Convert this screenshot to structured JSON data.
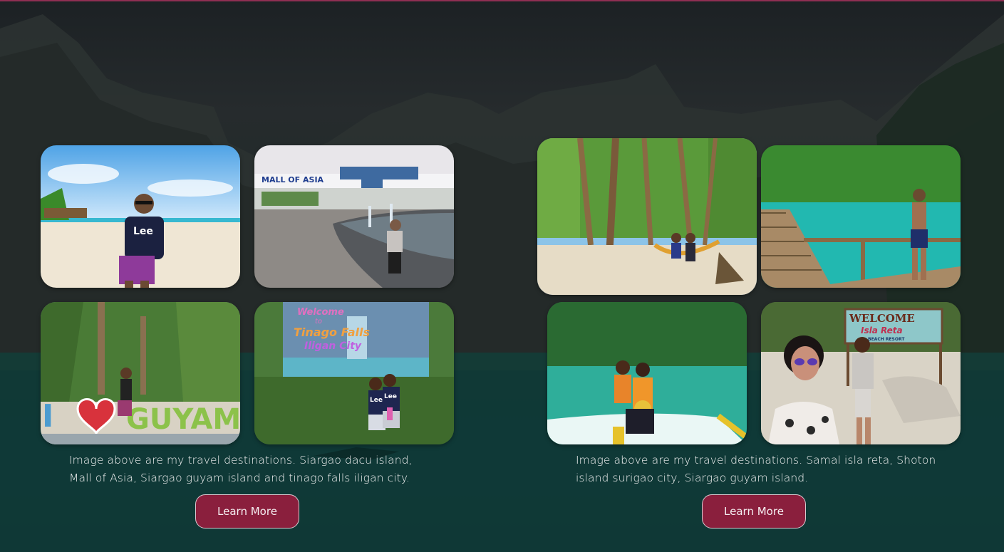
{
  "gallery_left": {
    "photos": [
      {
        "name": "siargao-dacu-island",
        "badge_text": "Lee"
      },
      {
        "name": "mall-of-asia",
        "sign_text": "MALL OF ASIA"
      },
      {
        "name": "siargao-guyam-island",
        "sign_text": "I ♥ GUYAM"
      },
      {
        "name": "tinago-falls",
        "sign_lines": [
          "Welcome",
          "to",
          "Tinago Falls",
          "Iligan City"
        ],
        "badge_text": "Lee"
      }
    ],
    "caption": "Image above are my travel destinations. Siargao dacu island, Mall of Asia, Siargao guyam island and tinago falls iligan city.",
    "button_label": "Learn More"
  },
  "gallery_right": {
    "photos": [
      {
        "name": "samal-isla-reta-palms"
      },
      {
        "name": "shoton-island-lagoon"
      },
      {
        "name": "lagoon-boat-ride"
      },
      {
        "name": "isla-reta-welcome",
        "sign_lines": [
          "WELCOME",
          "Isla Reta",
          "BEACH RESORT"
        ]
      }
    ],
    "caption": "Image above are my travel destinations. Samal isla reta, Shoton island surigao city, Siargao guyam island.",
    "button_label": "Learn More"
  },
  "colors": {
    "accent": "#8a1f3d",
    "top_border": "#8e2f52",
    "text": "#f2f2f2"
  }
}
